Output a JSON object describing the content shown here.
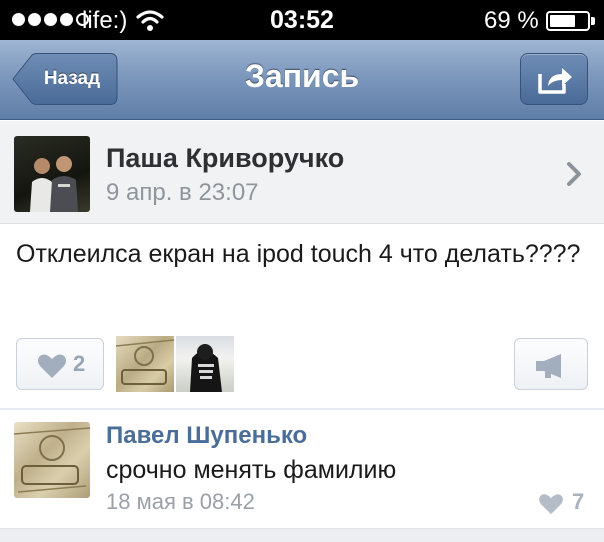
{
  "status_bar": {
    "carrier": "life:)",
    "time": "03:52",
    "battery_percent_label": "69 %",
    "battery_level": 0.69
  },
  "navbar": {
    "back_label": "Назад",
    "title": "Запись",
    "share_icon": "share-icon"
  },
  "post": {
    "author": "Паша Криворучко",
    "date": "9 апр. в 23:07",
    "text": "Отклеилса екран на ipod touch 4 что делать????",
    "likes": "2"
  },
  "comment": {
    "author": "Павел Шупенько",
    "text": "срочно менять фамилию",
    "date": "18 мая в 08:42",
    "likes": "7"
  },
  "colors": {
    "navbar_top": "#9fb6d3",
    "navbar_bottom": "#5f7ea7",
    "link_blue": "#4a6e97",
    "secondary_gray": "#8f959c"
  }
}
